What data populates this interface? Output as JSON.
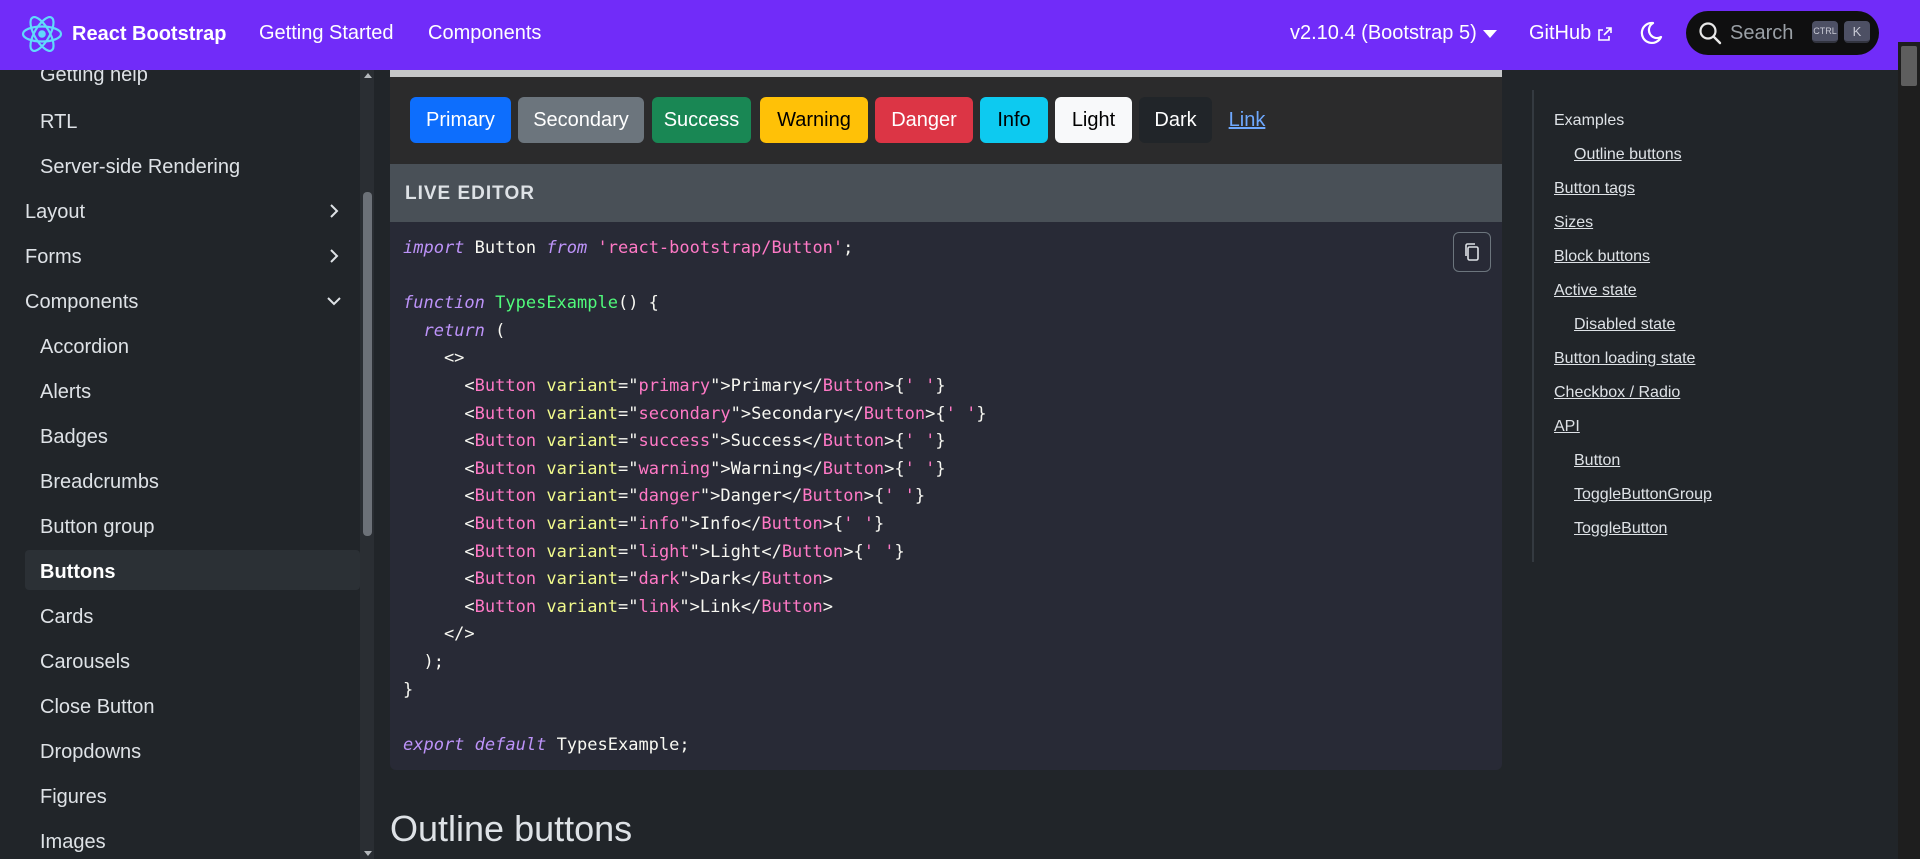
{
  "navbar": {
    "brand": "React Bootstrap",
    "links": [
      "Getting Started",
      "Components"
    ],
    "version": "v2.10.4 (Bootstrap 5)",
    "github": "GitHub",
    "search_placeholder": "Search",
    "kbd_ctrl": "CTRL",
    "kbd_k": "K",
    "accent": "#712cf9"
  },
  "sidebar": {
    "items": [
      {
        "label": "Getting help"
      },
      {
        "label": "RTL"
      },
      {
        "label": "Server-side Rendering"
      },
      {
        "label": "Layout"
      },
      {
        "label": "Forms"
      },
      {
        "label": "Components"
      },
      {
        "label": "Accordion"
      },
      {
        "label": "Alerts"
      },
      {
        "label": "Badges"
      },
      {
        "label": "Breadcrumbs"
      },
      {
        "label": "Button group"
      },
      {
        "label": "Buttons"
      },
      {
        "label": "Cards"
      },
      {
        "label": "Carousels"
      },
      {
        "label": "Close Button"
      },
      {
        "label": "Dropdowns"
      },
      {
        "label": "Figures"
      },
      {
        "label": "Images"
      }
    ]
  },
  "example": {
    "buttons": [
      "Primary",
      "Secondary",
      "Success",
      "Warning",
      "Danger",
      "Info",
      "Light",
      "Dark",
      "Link"
    ]
  },
  "editor": {
    "title": "LIVE EDITOR",
    "import_kw": "import",
    "import_name": " Button ",
    "from_kw": "from",
    "import_path": "'react-bootstrap/Button'",
    "function_kw": "function",
    "fn_name": "TypesExample",
    "return_kw": "return",
    "export_kw": "export",
    "default_kw": "default",
    "export_name": " TypesExample;",
    "variants": [
      {
        "variant": "primary",
        "label": "Primary",
        "space": true
      },
      {
        "variant": "secondary",
        "label": "Secondary",
        "space": true
      },
      {
        "variant": "success",
        "label": "Success",
        "space": true
      },
      {
        "variant": "warning",
        "label": "Warning",
        "space": true
      },
      {
        "variant": "danger",
        "label": "Danger",
        "space": true
      },
      {
        "variant": "info",
        "label": "Info",
        "space": true
      },
      {
        "variant": "light",
        "label": "Light",
        "space": true
      },
      {
        "variant": "dark",
        "label": "Dark",
        "space": false
      },
      {
        "variant": "link",
        "label": "Link",
        "space": false
      }
    ]
  },
  "main": {
    "outline_heading": "Outline buttons"
  },
  "toc": {
    "items": [
      {
        "label": "Examples",
        "level": 1
      },
      {
        "label": "Outline buttons",
        "level": 2
      },
      {
        "label": "Button tags",
        "level": 1
      },
      {
        "label": "Sizes",
        "level": 1
      },
      {
        "label": "Block buttons",
        "level": 1
      },
      {
        "label": "Active state",
        "level": 1
      },
      {
        "label": "Disabled state",
        "level": 2
      },
      {
        "label": "Button loading state",
        "level": 1
      },
      {
        "label": "Checkbox / Radio",
        "level": 1
      },
      {
        "label": "API",
        "level": 1
      },
      {
        "label": "Button",
        "level": 2
      },
      {
        "label": "ToggleButtonGroup",
        "level": 2
      },
      {
        "label": "ToggleButton",
        "level": 2
      }
    ]
  }
}
